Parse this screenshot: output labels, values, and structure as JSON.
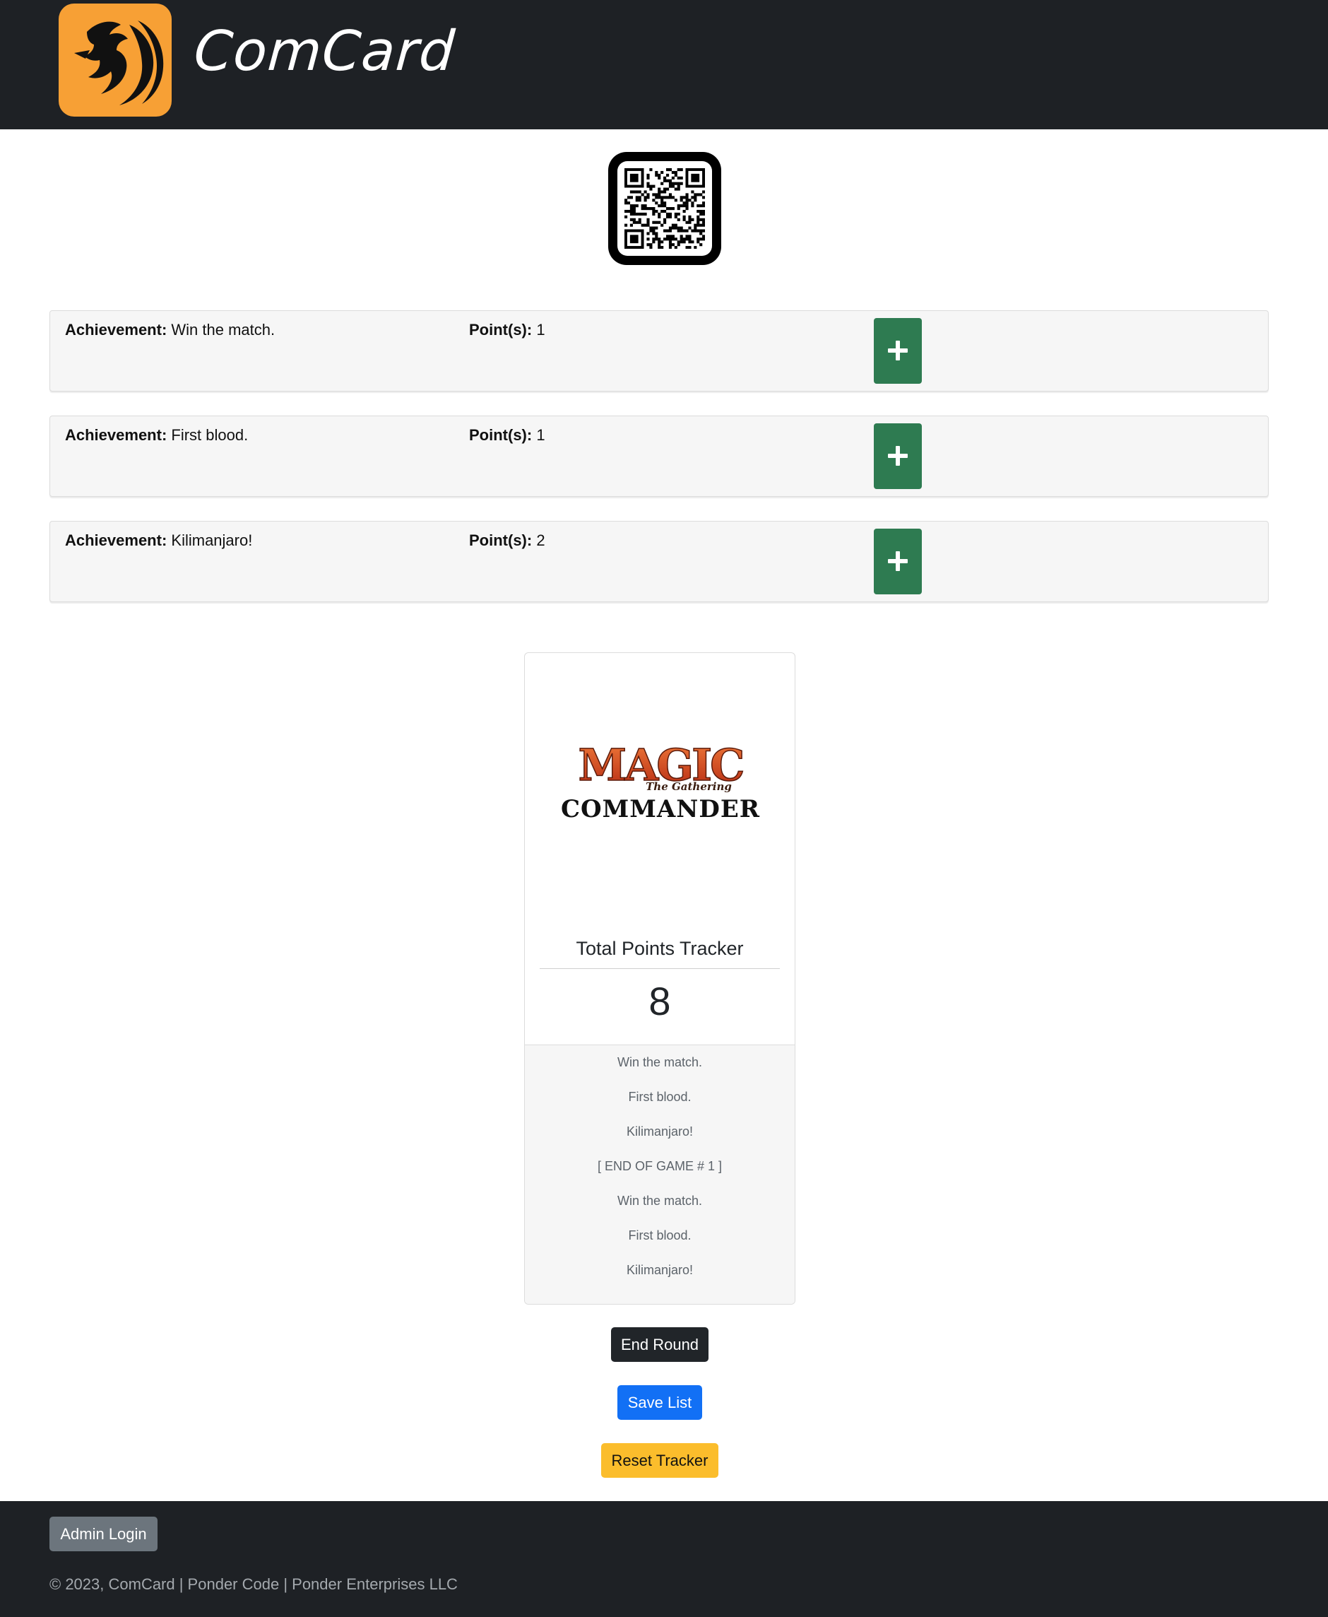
{
  "header": {
    "brand": "ComCard"
  },
  "achievements": [
    {
      "label": "Achievement:",
      "name": "Win the match.",
      "points_label": "Point(s):",
      "points": "1"
    },
    {
      "label": "Achievement:",
      "name": "First blood.",
      "points_label": "Point(s):",
      "points": "1"
    },
    {
      "label": "Achievement:",
      "name": "Kilimanjaro!",
      "points_label": "Point(s):",
      "points": "2"
    }
  ],
  "tracker": {
    "logo_text_top": "MAGIC",
    "logo_text_sub": "The Gathering",
    "logo_text_bottom": "COMMANDER",
    "title": "Total Points Tracker",
    "total": "8",
    "log": [
      "Win the match.",
      "First blood.",
      "Kilimanjaro!",
      "[ END OF GAME # 1 ]",
      "Win the match.",
      "First blood.",
      "Kilimanjaro!"
    ]
  },
  "buttons": {
    "end_round": "End Round",
    "save_list": "Save List",
    "reset_tracker": "Reset Tracker"
  },
  "footer": {
    "admin_login": "Admin Login",
    "copyright": "© 2023, ComCard | Ponder Code | Ponder Enterprises LLC"
  },
  "colors": {
    "navbar": "#1e2125",
    "logo_bg": "#f7a035",
    "add_button": "#2e7b51",
    "save_button": "#1270f5",
    "reset_button": "#fbbd2c"
  }
}
